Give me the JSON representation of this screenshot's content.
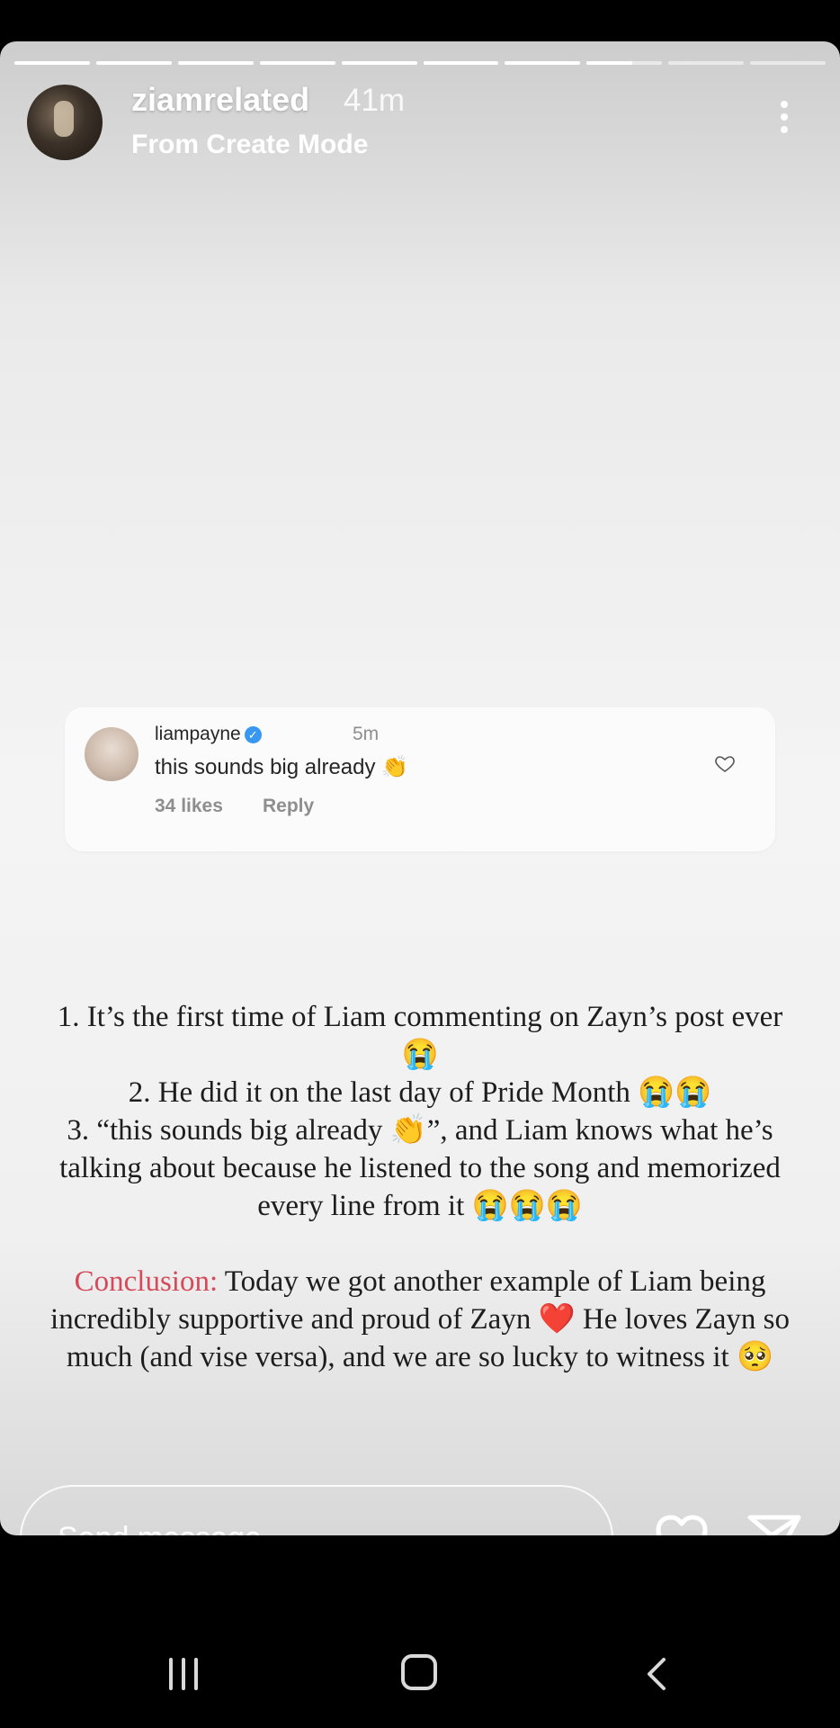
{
  "story": {
    "username": "ziamrelated",
    "time": "41m",
    "subtitle": "From Create Mode",
    "progress": [
      1,
      1,
      1,
      1,
      1,
      1,
      1,
      0.6,
      0,
      0
    ]
  },
  "comment": {
    "username": "liampayne",
    "time": "5m",
    "text": "this sounds big already 👏",
    "likes": "34 likes",
    "reply": "Reply"
  },
  "post_text": {
    "line1": "1. It’s the first time of Liam commenting on Zayn’s post ever 😭",
    "line2": "2. He did it on the last day of Pride Month 😭😭",
    "line3": "3. “this sounds big already 👏”, and Liam knows what he’s talking about because he listened to the song and memorized every line from it 😭😭😭",
    "conclusion_label": "Conclusion:",
    "conclusion_text": " Today we got another example of Liam being incredibly supportive and proud of Zayn ❤️ He loves Zayn so much (and vise versa), and we are so lucky to witness it 🥺"
  },
  "footer": {
    "message_placeholder": "Send message"
  },
  "colors": {
    "accent_red": "#d44a5a",
    "verified_blue": "#3897f0"
  },
  "icons": [
    "more-icon",
    "verified-icon",
    "heart-icon",
    "send-icon",
    "recent-apps-icon",
    "home-icon",
    "back-icon"
  ]
}
